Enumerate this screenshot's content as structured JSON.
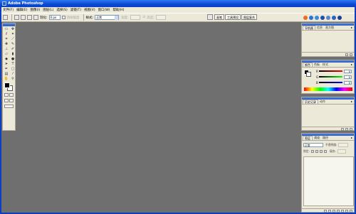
{
  "window": {
    "title": "Adobe Photoshop"
  },
  "menu": [
    "文件(F)",
    "编辑(E)",
    "图像(I)",
    "图层(L)",
    "选择(S)",
    "滤镜(T)",
    "视图(V)",
    "窗口(W)",
    "帮助(H)"
  ],
  "options": {
    "feather_label": "羽化:",
    "feather_value": "0 px",
    "antialias_label": "消除锯齿",
    "style_label": "样式:",
    "style_value": "正常",
    "width_label": "宽度:",
    "height_label": "高度:"
  },
  "palette_well": {
    "tabs": [
      "画笔",
      "工具预设",
      "图层复合"
    ]
  },
  "navigator": {
    "tabs": [
      "导航器",
      "信息",
      "直方图"
    ]
  },
  "color": {
    "tabs": [
      "颜色",
      "色板",
      "样式"
    ],
    "channels": [
      {
        "label": "R",
        "value": "0"
      },
      {
        "label": "G",
        "value": "0"
      },
      {
        "label": "B",
        "value": "0"
      }
    ]
  },
  "history": {
    "tabs": [
      "历史记录",
      "动作"
    ]
  },
  "layers": {
    "tabs": [
      "图层",
      "通道",
      "路径"
    ],
    "blend_mode": "正常",
    "opacity_label": "不透明度:",
    "lock_label": "锁定:",
    "fill_label": "填充:"
  },
  "colors": {
    "title_bar": "#0a49d6",
    "workspace": "#6f6f6f",
    "panel": "#ece9d8"
  }
}
